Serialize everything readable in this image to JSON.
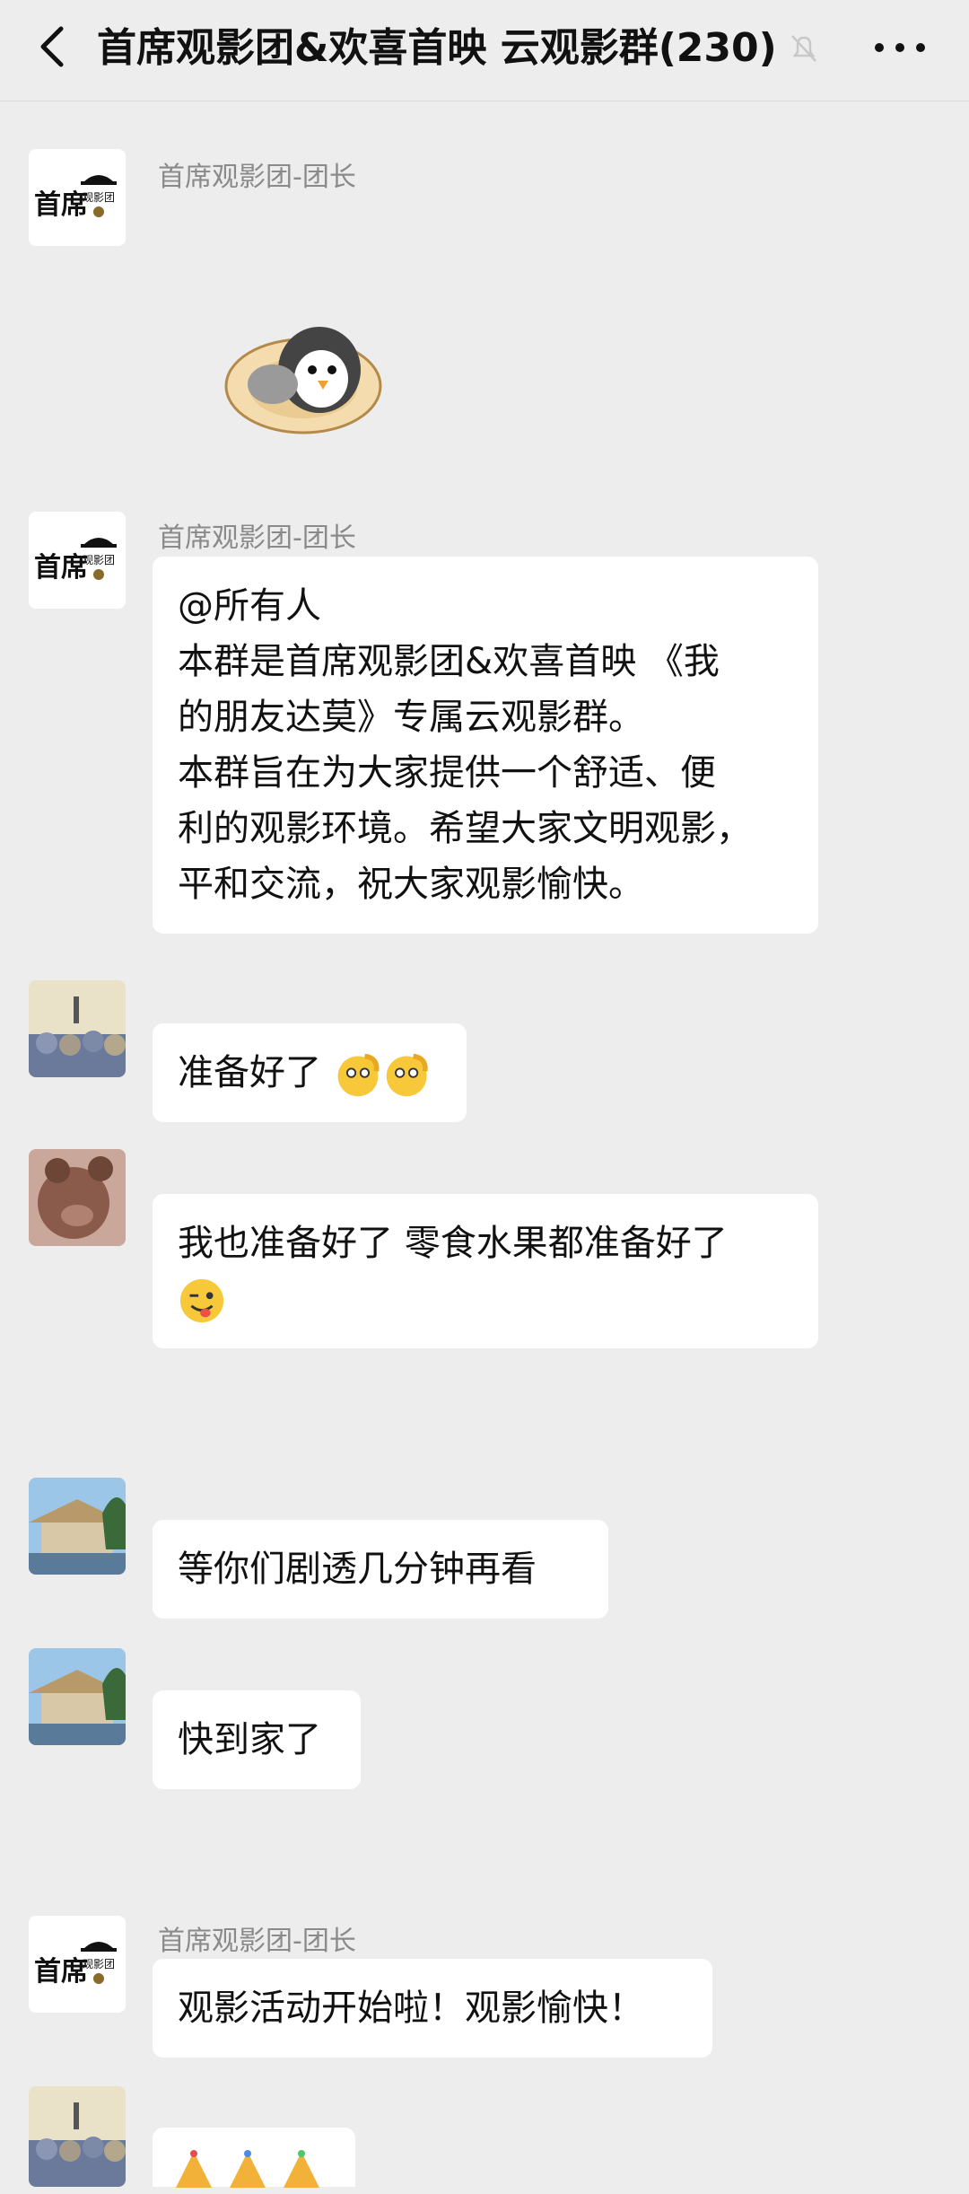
{
  "header": {
    "title": "首席观影团&欢喜首映 云观影群(230)",
    "back_icon": "chevron-left-icon",
    "mute_icon": "bell-off-icon",
    "more_icon": "more-dots-icon"
  },
  "messages": [
    {
      "sender": "首席观影团-团长",
      "type": "sticker",
      "sticker": "penguin-in-nest-sticker"
    },
    {
      "sender": "首席观影团-团长",
      "lines": [
        "@所有人",
        "本群是首席观影团&欢喜首映 《我",
        "的朋友达莫》专属云观影群。",
        "本群旨在为大家提供一个舒适、便",
        "利的观影环境。希望大家文明观影，",
        "平和交流，祝大家观影愉快。"
      ]
    },
    {
      "sender": "",
      "text": "准备好了",
      "emoji": "salute-emoji"
    },
    {
      "sender": "",
      "text": "我也准备好了 零食水果都准备好了",
      "emoji": "wink-tongue-emoji"
    },
    {
      "sender": "",
      "text": "等你们剧透几分钟再看"
    },
    {
      "sender": "",
      "text": "快到家了"
    },
    {
      "sender": "首席观影团-团长",
      "text": "观影活动开始啦！观影愉快！"
    },
    {
      "sender": "",
      "emoji": "party-emoji"
    }
  ],
  "avatar_logo_text": "首席观影团",
  "colors": {
    "background": "#ededed",
    "bubble": "#ffffff",
    "sender": "#8a8a8a"
  }
}
